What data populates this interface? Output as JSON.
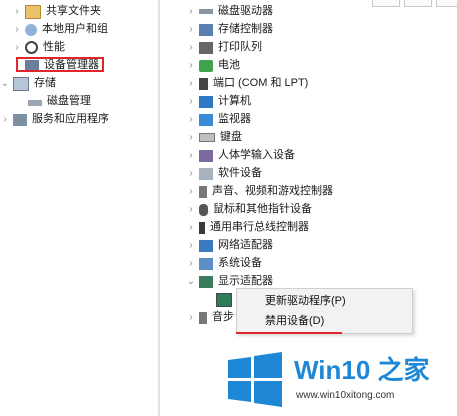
{
  "left_tree": [
    {
      "label": "共享文件夹",
      "icon": "shared-folder-icon"
    },
    {
      "label": "本地用户和组",
      "icon": "users-icon"
    },
    {
      "label": "性能",
      "icon": "performance-icon"
    },
    {
      "label": "设备管理器",
      "icon": "device-manager-icon"
    },
    {
      "label": "存储",
      "icon": "storage-icon"
    },
    {
      "label": "磁盘管理",
      "icon": "disk-management-icon"
    },
    {
      "label": "服务和应用程序",
      "icon": "services-icon"
    }
  ],
  "device_tree": [
    {
      "label": "磁盘驱动器",
      "icon": "disk-drive-icon"
    },
    {
      "label": "存储控制器",
      "icon": "storage-controller-icon"
    },
    {
      "label": "打印队列",
      "icon": "print-queue-icon"
    },
    {
      "label": "电池",
      "icon": "battery-icon"
    },
    {
      "label": "端口 (COM 和 LPT)",
      "icon": "port-icon"
    },
    {
      "label": "计算机",
      "icon": "computer-icon"
    },
    {
      "label": "监视器",
      "icon": "monitor-icon"
    },
    {
      "label": "键盘",
      "icon": "keyboard-icon"
    },
    {
      "label": "人体学输入设备",
      "icon": "hid-icon"
    },
    {
      "label": "软件设备",
      "icon": "software-device-icon"
    },
    {
      "label": "声音、视频和游戏控制器",
      "icon": "sound-icon"
    },
    {
      "label": "鼠标和其他指针设备",
      "icon": "mouse-icon"
    },
    {
      "label": "通用串行总线控制器",
      "icon": "usb-icon"
    },
    {
      "label": "网络适配器",
      "icon": "network-adapter-icon"
    },
    {
      "label": "系统设备",
      "icon": "system-device-icon"
    },
    {
      "label": "显示适配器",
      "icon": "display-adapter-icon"
    }
  ],
  "partial_row": {
    "label": "音步"
  },
  "context_menu": {
    "items": [
      {
        "label": "更新驱动程序(P)"
      },
      {
        "label": "禁用设备(D)"
      }
    ]
  },
  "watermark": {
    "title": "Win10 之家",
    "url": "www.win10xitong.com"
  },
  "colors": {
    "highlight": "#e0252b",
    "brand_blue": "#1e88d6"
  }
}
